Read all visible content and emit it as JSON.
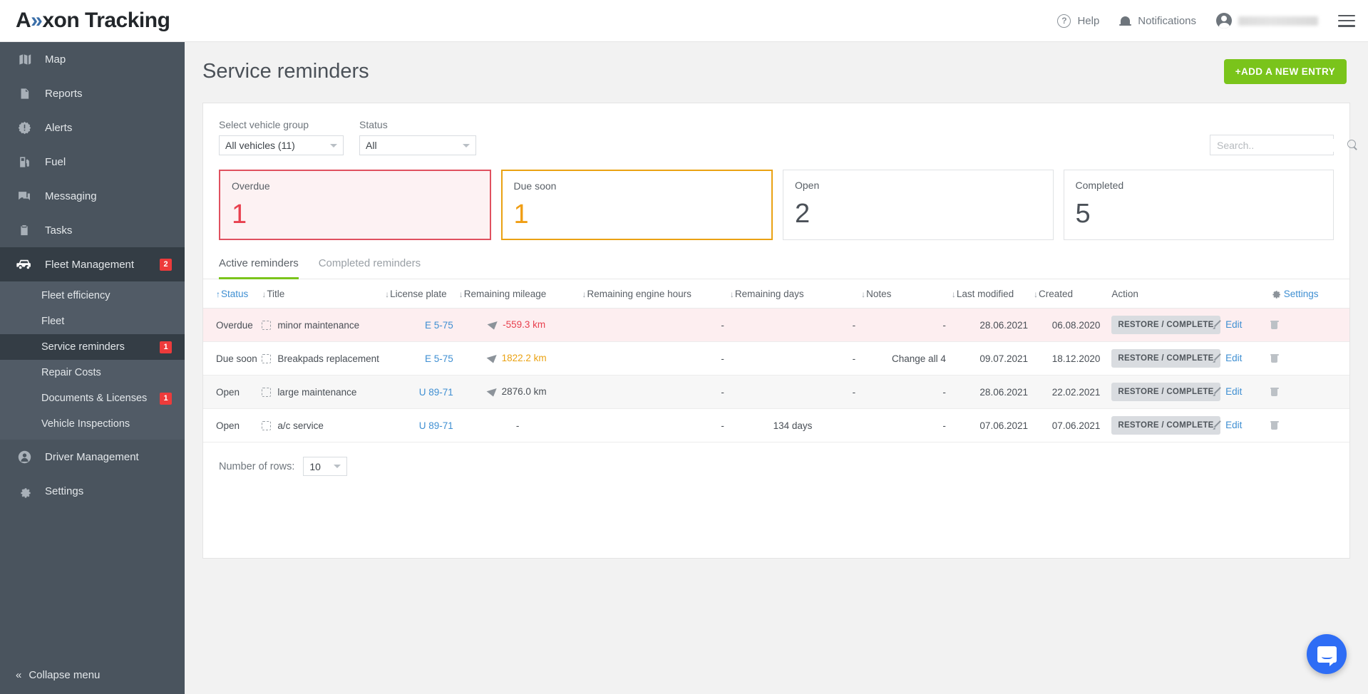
{
  "brand": {
    "name_part1": "A",
    "chevron": "»",
    "name_part2": "xon Tracking"
  },
  "topbar": {
    "help": "Help",
    "notifications": "Notifications",
    "help_icon": "question-circle-icon",
    "bell_icon": "bell-icon",
    "avatar_icon": "account-circle-icon",
    "menu_icon": "hamburger-menu-icon"
  },
  "sidebar": {
    "items": [
      {
        "label": "Map",
        "icon": "map-icon",
        "badge": ""
      },
      {
        "label": "Reports",
        "icon": "document-icon",
        "badge": ""
      },
      {
        "label": "Alerts",
        "icon": "alert-badge-icon",
        "badge": ""
      },
      {
        "label": "Fuel",
        "icon": "fuel-pump-icon",
        "badge": ""
      },
      {
        "label": "Messaging",
        "icon": "chat-icon",
        "badge": ""
      },
      {
        "label": "Tasks",
        "icon": "clipboard-icon",
        "badge": ""
      },
      {
        "label": "Fleet Management",
        "icon": "car-icon",
        "badge": "2"
      }
    ],
    "sub_items": [
      {
        "label": "Fleet efficiency",
        "badge": ""
      },
      {
        "label": "Fleet",
        "badge": ""
      },
      {
        "label": "Service reminders",
        "badge": "1"
      },
      {
        "label": "Repair Costs",
        "badge": ""
      },
      {
        "label": "Documents & Licenses",
        "badge": "1"
      },
      {
        "label": "Vehicle Inspections",
        "badge": ""
      }
    ],
    "bottom_items": [
      {
        "label": "Driver Management",
        "icon": "user-circle-icon"
      },
      {
        "label": "Settings",
        "icon": "gear-icon"
      }
    ],
    "collapse": "Collapse menu"
  },
  "page": {
    "title": "Service reminders",
    "add_button": "+ADD A NEW ENTRY"
  },
  "filters": {
    "vehicle_group_label": "Select vehicle group",
    "vehicle_group_value": "All vehicles (11)",
    "status_label": "Status",
    "status_value": "All",
    "search_placeholder": "Search.."
  },
  "cards": [
    {
      "label": "Overdue",
      "value": "1",
      "accent": "#e0515f"
    },
    {
      "label": "Due soon",
      "value": "1",
      "accent": "#eaa213"
    },
    {
      "label": "Open",
      "value": "2",
      "accent": "#e0e2e4"
    },
    {
      "label": "Completed",
      "value": "5",
      "accent": "#e0e2e4"
    }
  ],
  "tabs": [
    {
      "label": "Active reminders",
      "active": true
    },
    {
      "label": "Completed reminders",
      "active": false
    }
  ],
  "table": {
    "columns": [
      {
        "label": "Status",
        "sort": "up",
        "sorted": true
      },
      {
        "label": "Title",
        "sort": "down",
        "sorted": false
      },
      {
        "label": "License plate",
        "sort": "down",
        "sorted": false
      },
      {
        "label": "Remaining mileage",
        "sort": "down",
        "sorted": false
      },
      {
        "label": "Remaining engine hours",
        "sort": "down",
        "sorted": false
      },
      {
        "label": "Remaining days",
        "sort": "down",
        "sorted": false
      },
      {
        "label": "Notes",
        "sort": "down",
        "sorted": false
      },
      {
        "label": "Last modified",
        "sort": "down",
        "sorted": false
      },
      {
        "label": "Created",
        "sort": "down",
        "sorted": false
      },
      {
        "label": "Action",
        "sort": "",
        "sorted": false
      }
    ],
    "settings_label": "Settings",
    "settings_icon": "gear-icon",
    "rows": [
      {
        "status": "Overdue",
        "status_kind": "overdue",
        "title": "minor maintenance",
        "plate": "E 5-75",
        "mileage": "-559.3 km",
        "mileage_color": "#e8414f",
        "mileage_pct": 100,
        "engine_hours": "-",
        "days": "-",
        "days_pct": 0,
        "notes": "-",
        "last_modified": "28.06.2021",
        "created": "06.08.2020",
        "action": "RESTORE / COMPLETE",
        "edit": "Edit"
      },
      {
        "status": "Due soon",
        "status_kind": "duesoon",
        "title": "Breakpads replacement",
        "plate": "E 5-75",
        "mileage": "1822.2 km",
        "mileage_color": "#eaa213",
        "mileage_pct": 82,
        "engine_hours": "-",
        "days": "-",
        "days_pct": 0,
        "notes": "Change all 4",
        "last_modified": "09.07.2021",
        "created": "18.12.2020",
        "action": "RESTORE / COMPLETE",
        "edit": "Edit"
      },
      {
        "status": "Open",
        "status_kind": "open",
        "title": "large maintenance",
        "plate": "U 89-71",
        "mileage": "2876.0 km",
        "mileage_color": "#494f56",
        "mileage_pct": 80,
        "engine_hours": "-",
        "days": "-",
        "days_pct": 0,
        "notes": "-",
        "last_modified": "28.06.2021",
        "created": "22.02.2021",
        "action": "RESTORE / COMPLETE",
        "edit": "Edit"
      },
      {
        "status": "Open",
        "status_kind": "open",
        "title": "a/c service",
        "plate": "U 89-71",
        "mileage": "-",
        "mileage_color": "#494f56",
        "mileage_pct": 0,
        "engine_hours": "-",
        "days": "134 days",
        "days_pct": 22,
        "notes": "-",
        "last_modified": "07.06.2021",
        "created": "07.06.2021",
        "action": "RESTORE / COMPLETE",
        "edit": "Edit"
      }
    ]
  },
  "footer": {
    "rows_label": "Number of rows:",
    "rows_value": "10"
  },
  "chat": {
    "icon": "chat-bubble-icon"
  }
}
